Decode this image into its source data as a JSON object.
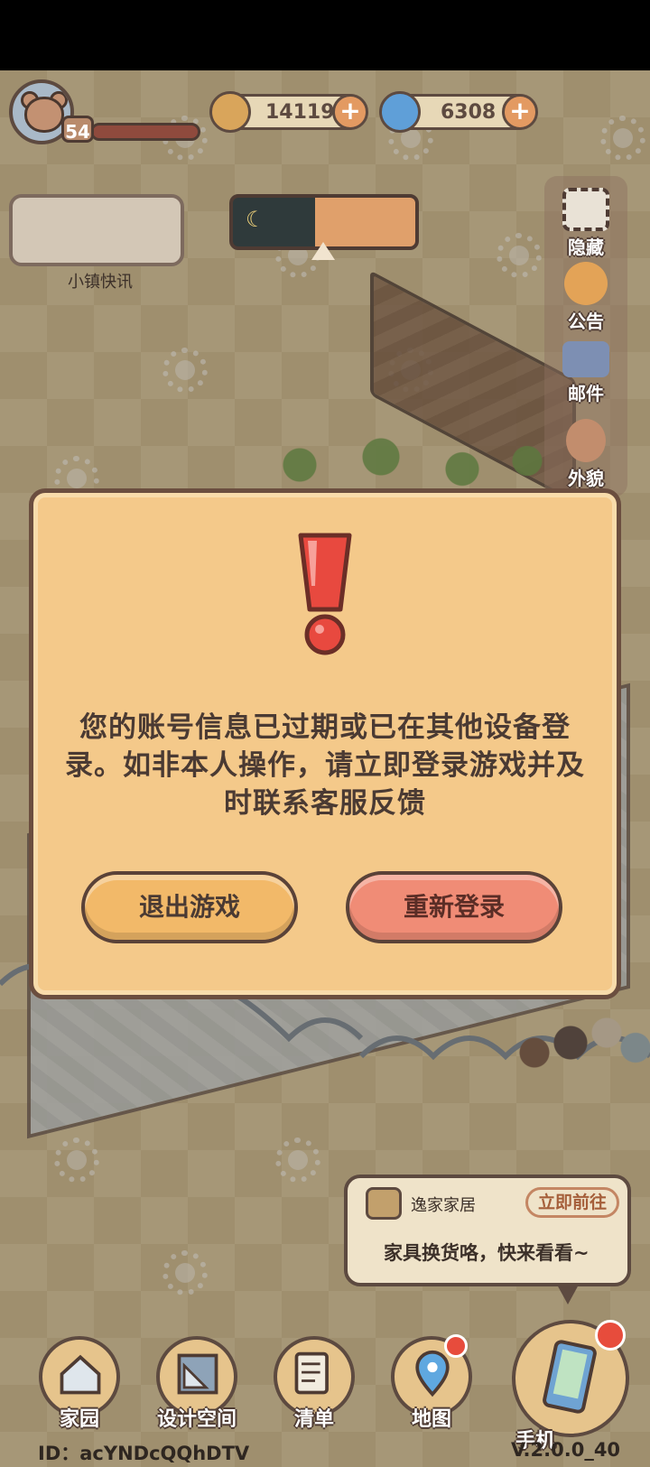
{
  "hud": {
    "level": "54",
    "coins": "141197",
    "gems": "6308",
    "news_label": "小镇快讯"
  },
  "side_menu": [
    {
      "label": "隐藏",
      "icon": "hide-frame-icon"
    },
    {
      "label": "公告",
      "icon": "announcement-icon"
    },
    {
      "label": "邮件",
      "icon": "mail-icon"
    },
    {
      "label": "外貌",
      "icon": "appearance-icon"
    }
  ],
  "dialog": {
    "message": "您的账号信息已过期或已在其他设备登录。如非本人操作，请立即登录游戏并及时联系客服反馈",
    "exit_label": "退出游戏",
    "relogin_label": "重新登录"
  },
  "notice": {
    "title": "逸家家居",
    "go_label": "立即前往",
    "body": "家具换货咯，快来看看~"
  },
  "nav": [
    {
      "label": "家园",
      "icon": "house-icon"
    },
    {
      "label": "设计空间",
      "icon": "design-ruler-icon"
    },
    {
      "label": "清单",
      "icon": "list-quill-icon"
    },
    {
      "label": "地图",
      "icon": "map-pin-icon"
    },
    {
      "label": "手机",
      "icon": "phone-icon"
    }
  ],
  "footer": {
    "id_text": "ID：acYNDcQQhDTV",
    "version": "V.2.0.0_40"
  },
  "colors": {
    "dialog_bg": "#f4c98a",
    "exit_button": "#f2b969",
    "relogin_button": "#f08c76",
    "alert_red": "#e8493f"
  }
}
